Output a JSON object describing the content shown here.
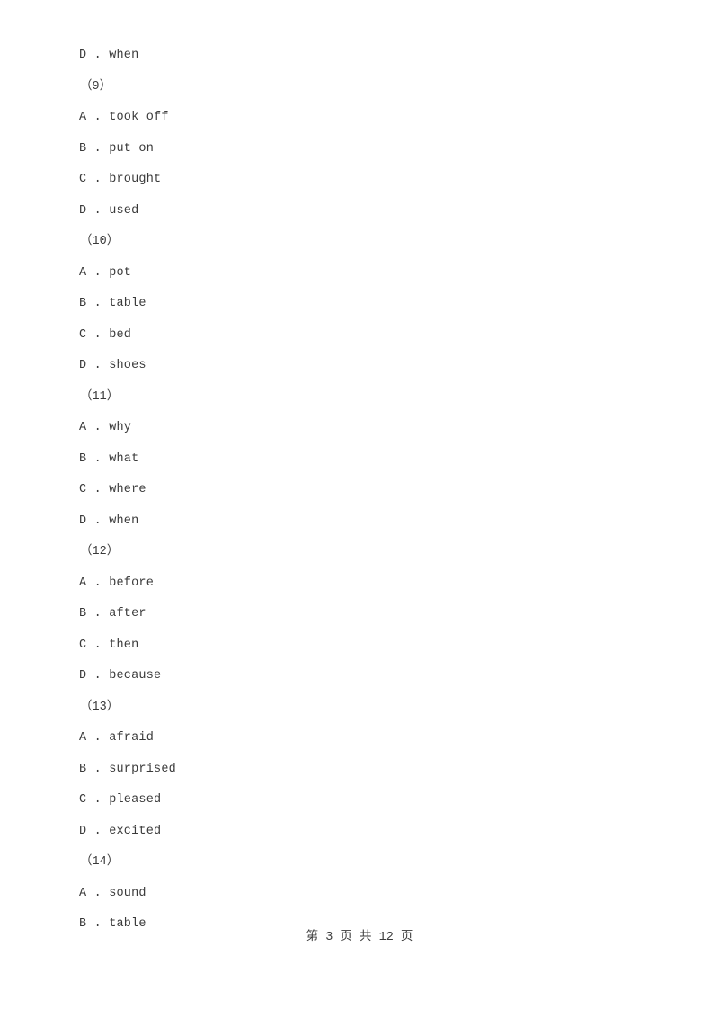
{
  "document": {
    "page_background": "#ffffff",
    "text_color": "#3a3a3a",
    "lines": [
      {
        "kind": "option",
        "text": "D . when"
      },
      {
        "kind": "qnum",
        "text": "（9）"
      },
      {
        "kind": "option",
        "text": "A . took off"
      },
      {
        "kind": "option",
        "text": "B . put on"
      },
      {
        "kind": "option",
        "text": "C . brought"
      },
      {
        "kind": "option",
        "text": "D . used"
      },
      {
        "kind": "qnum",
        "text": "（10）"
      },
      {
        "kind": "option",
        "text": "A . pot"
      },
      {
        "kind": "option",
        "text": "B . table"
      },
      {
        "kind": "option",
        "text": "C . bed"
      },
      {
        "kind": "option",
        "text": "D . shoes"
      },
      {
        "kind": "qnum",
        "text": "（11）"
      },
      {
        "kind": "option",
        "text": "A . why"
      },
      {
        "kind": "option",
        "text": "B . what"
      },
      {
        "kind": "option",
        "text": "C . where"
      },
      {
        "kind": "option",
        "text": "D . when"
      },
      {
        "kind": "qnum",
        "text": "（12）"
      },
      {
        "kind": "option",
        "text": "A . before"
      },
      {
        "kind": "option",
        "text": "B . after"
      },
      {
        "kind": "option",
        "text": "C . then"
      },
      {
        "kind": "option",
        "text": "D . because"
      },
      {
        "kind": "qnum",
        "text": "（13）"
      },
      {
        "kind": "option",
        "text": "A . afraid"
      },
      {
        "kind": "option",
        "text": "B . surprised"
      },
      {
        "kind": "option",
        "text": "C . pleased"
      },
      {
        "kind": "option",
        "text": "D . excited"
      },
      {
        "kind": "qnum",
        "text": "（14）"
      },
      {
        "kind": "option",
        "text": "A . sound"
      },
      {
        "kind": "option",
        "text": "B . table"
      }
    ]
  },
  "footer": {
    "page_label": "第 3 页 共 12 页",
    "current_page": 3,
    "total_pages": 12
  }
}
